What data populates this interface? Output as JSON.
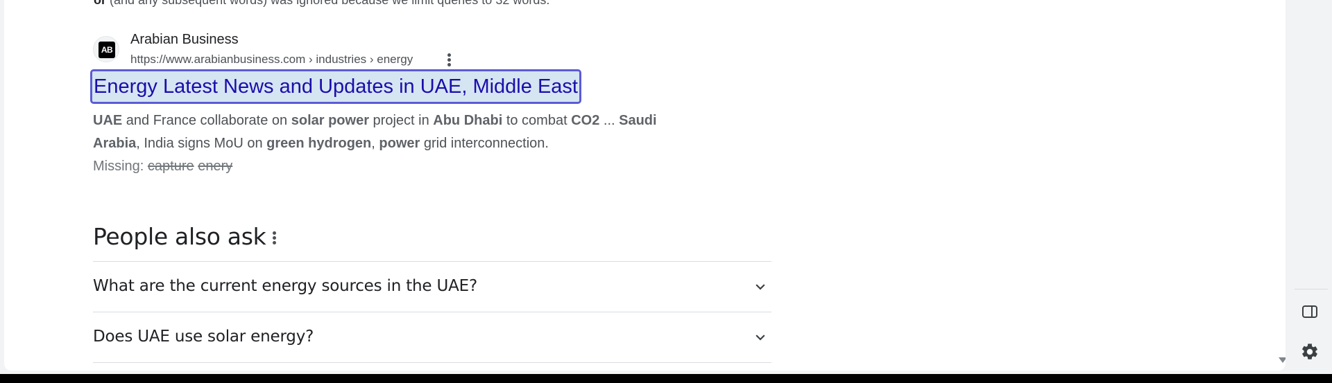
{
  "top_notice": {
    "word": "or",
    "text": "(and any subsequent words) was ignored because we limit queries to 32 words."
  },
  "result": {
    "favicon_text": "AB",
    "site_name": "Arabian Business",
    "url": "https://www.arabianbusiness.com › industries › energy",
    "title": "Energy Latest News and Updates in UAE, Middle East",
    "snippet_line1": [
      {
        "t": "UAE",
        "b": true
      },
      {
        "t": " and France collaborate on ",
        "b": false
      },
      {
        "t": "solar power",
        "b": true
      },
      {
        "t": " project in ",
        "b": false
      },
      {
        "t": "Abu Dhabi",
        "b": true
      },
      {
        "t": " to combat ",
        "b": false
      },
      {
        "t": "CO2",
        "b": true
      },
      {
        "t": " ... ",
        "b": false
      },
      {
        "t": "Saudi",
        "b": true
      }
    ],
    "snippet_line2": [
      {
        "t": "Arabia",
        "b": true
      },
      {
        "t": ", India signs MoU on ",
        "b": false
      },
      {
        "t": "green hydrogen",
        "b": true
      },
      {
        "t": ", ",
        "b": false
      },
      {
        "t": "power",
        "b": true
      },
      {
        "t": " grid interconnection.",
        "b": false
      }
    ],
    "missing_label": "Missing:",
    "missing_words": [
      "capture",
      "enery"
    ]
  },
  "people_also_ask": {
    "title": "People also ask",
    "questions": [
      "What are the current energy sources in the UAE?",
      "Does UAE use solar energy?"
    ]
  },
  "icons": {
    "result_menu": "more-vert-icon",
    "paa_menu": "more-vert-icon",
    "expand": "chevron-down-icon",
    "side_panel": "side-panel-icon",
    "settings": "gear-icon",
    "scroll": "scroll-down-arrow-icon"
  },
  "colors": {
    "link": "#1a0dab",
    "focus_ring": "#5b5bd6",
    "highlight_bg": "#d6e5f2",
    "text": "#202124",
    "muted": "#4d5156"
  }
}
